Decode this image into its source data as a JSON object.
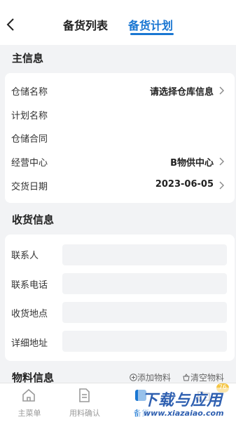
{
  "header": {
    "tabs": [
      {
        "label": "备货列表",
        "active": false
      },
      {
        "label": "备货计划",
        "active": true
      }
    ],
    "accent_color": "#1976d2"
  },
  "main_info": {
    "title": "主信息",
    "rows": [
      {
        "label": "仓储名称",
        "value": "请选择仓库信息",
        "has_arrow": true
      },
      {
        "label": "计划名称",
        "value": "",
        "has_arrow": false
      },
      {
        "label": "仓储合同",
        "value": "",
        "has_arrow": false
      },
      {
        "label": "经营中心",
        "value": "B物供中心",
        "has_arrow": true
      },
      {
        "label": "交货日期",
        "value": "2023-06-05",
        "has_arrow": true
      }
    ]
  },
  "receipt_info": {
    "title": "收货信息",
    "fields": [
      {
        "label": "联系人",
        "value": ""
      },
      {
        "label": "联系电话",
        "value": ""
      },
      {
        "label": "收货地点",
        "value": ""
      },
      {
        "label": "详细地址",
        "value": ""
      }
    ]
  },
  "material_info": {
    "title": "物料信息",
    "add_label": "添加物料",
    "clear_label": "清空物料"
  },
  "tabbar": {
    "items": [
      {
        "label": "主菜单",
        "icon": "home-icon"
      },
      {
        "label": "用料确认",
        "icon": "document-icon"
      },
      {
        "label": "备货",
        "icon": "stock-icon"
      },
      {
        "label": "",
        "icon": "folder-icon"
      }
    ],
    "badge": "76"
  },
  "watermark": {
    "main": "下载与应用",
    "sub": "www.xiazaiao.com"
  }
}
